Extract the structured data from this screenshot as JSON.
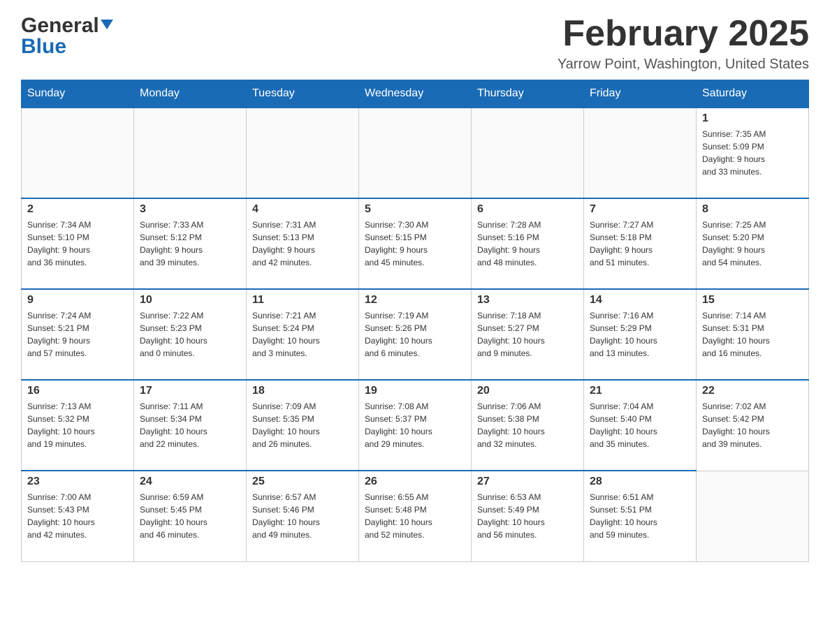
{
  "header": {
    "logo_general": "General",
    "logo_blue": "Blue",
    "month_title": "February 2025",
    "location": "Yarrow Point, Washington, United States"
  },
  "days_of_week": [
    "Sunday",
    "Monday",
    "Tuesday",
    "Wednesday",
    "Thursday",
    "Friday",
    "Saturday"
  ],
  "weeks": [
    [
      {
        "day": "",
        "info": ""
      },
      {
        "day": "",
        "info": ""
      },
      {
        "day": "",
        "info": ""
      },
      {
        "day": "",
        "info": ""
      },
      {
        "day": "",
        "info": ""
      },
      {
        "day": "",
        "info": ""
      },
      {
        "day": "1",
        "info": "Sunrise: 7:35 AM\nSunset: 5:09 PM\nDaylight: 9 hours\nand 33 minutes."
      }
    ],
    [
      {
        "day": "2",
        "info": "Sunrise: 7:34 AM\nSunset: 5:10 PM\nDaylight: 9 hours\nand 36 minutes."
      },
      {
        "day": "3",
        "info": "Sunrise: 7:33 AM\nSunset: 5:12 PM\nDaylight: 9 hours\nand 39 minutes."
      },
      {
        "day": "4",
        "info": "Sunrise: 7:31 AM\nSunset: 5:13 PM\nDaylight: 9 hours\nand 42 minutes."
      },
      {
        "day": "5",
        "info": "Sunrise: 7:30 AM\nSunset: 5:15 PM\nDaylight: 9 hours\nand 45 minutes."
      },
      {
        "day": "6",
        "info": "Sunrise: 7:28 AM\nSunset: 5:16 PM\nDaylight: 9 hours\nand 48 minutes."
      },
      {
        "day": "7",
        "info": "Sunrise: 7:27 AM\nSunset: 5:18 PM\nDaylight: 9 hours\nand 51 minutes."
      },
      {
        "day": "8",
        "info": "Sunrise: 7:25 AM\nSunset: 5:20 PM\nDaylight: 9 hours\nand 54 minutes."
      }
    ],
    [
      {
        "day": "9",
        "info": "Sunrise: 7:24 AM\nSunset: 5:21 PM\nDaylight: 9 hours\nand 57 minutes."
      },
      {
        "day": "10",
        "info": "Sunrise: 7:22 AM\nSunset: 5:23 PM\nDaylight: 10 hours\nand 0 minutes."
      },
      {
        "day": "11",
        "info": "Sunrise: 7:21 AM\nSunset: 5:24 PM\nDaylight: 10 hours\nand 3 minutes."
      },
      {
        "day": "12",
        "info": "Sunrise: 7:19 AM\nSunset: 5:26 PM\nDaylight: 10 hours\nand 6 minutes."
      },
      {
        "day": "13",
        "info": "Sunrise: 7:18 AM\nSunset: 5:27 PM\nDaylight: 10 hours\nand 9 minutes."
      },
      {
        "day": "14",
        "info": "Sunrise: 7:16 AM\nSunset: 5:29 PM\nDaylight: 10 hours\nand 13 minutes."
      },
      {
        "day": "15",
        "info": "Sunrise: 7:14 AM\nSunset: 5:31 PM\nDaylight: 10 hours\nand 16 minutes."
      }
    ],
    [
      {
        "day": "16",
        "info": "Sunrise: 7:13 AM\nSunset: 5:32 PM\nDaylight: 10 hours\nand 19 minutes."
      },
      {
        "day": "17",
        "info": "Sunrise: 7:11 AM\nSunset: 5:34 PM\nDaylight: 10 hours\nand 22 minutes."
      },
      {
        "day": "18",
        "info": "Sunrise: 7:09 AM\nSunset: 5:35 PM\nDaylight: 10 hours\nand 26 minutes."
      },
      {
        "day": "19",
        "info": "Sunrise: 7:08 AM\nSunset: 5:37 PM\nDaylight: 10 hours\nand 29 minutes."
      },
      {
        "day": "20",
        "info": "Sunrise: 7:06 AM\nSunset: 5:38 PM\nDaylight: 10 hours\nand 32 minutes."
      },
      {
        "day": "21",
        "info": "Sunrise: 7:04 AM\nSunset: 5:40 PM\nDaylight: 10 hours\nand 35 minutes."
      },
      {
        "day": "22",
        "info": "Sunrise: 7:02 AM\nSunset: 5:42 PM\nDaylight: 10 hours\nand 39 minutes."
      }
    ],
    [
      {
        "day": "23",
        "info": "Sunrise: 7:00 AM\nSunset: 5:43 PM\nDaylight: 10 hours\nand 42 minutes."
      },
      {
        "day": "24",
        "info": "Sunrise: 6:59 AM\nSunset: 5:45 PM\nDaylight: 10 hours\nand 46 minutes."
      },
      {
        "day": "25",
        "info": "Sunrise: 6:57 AM\nSunset: 5:46 PM\nDaylight: 10 hours\nand 49 minutes."
      },
      {
        "day": "26",
        "info": "Sunrise: 6:55 AM\nSunset: 5:48 PM\nDaylight: 10 hours\nand 52 minutes."
      },
      {
        "day": "27",
        "info": "Sunrise: 6:53 AM\nSunset: 5:49 PM\nDaylight: 10 hours\nand 56 minutes."
      },
      {
        "day": "28",
        "info": "Sunrise: 6:51 AM\nSunset: 5:51 PM\nDaylight: 10 hours\nand 59 minutes."
      },
      {
        "day": "",
        "info": ""
      }
    ]
  ]
}
